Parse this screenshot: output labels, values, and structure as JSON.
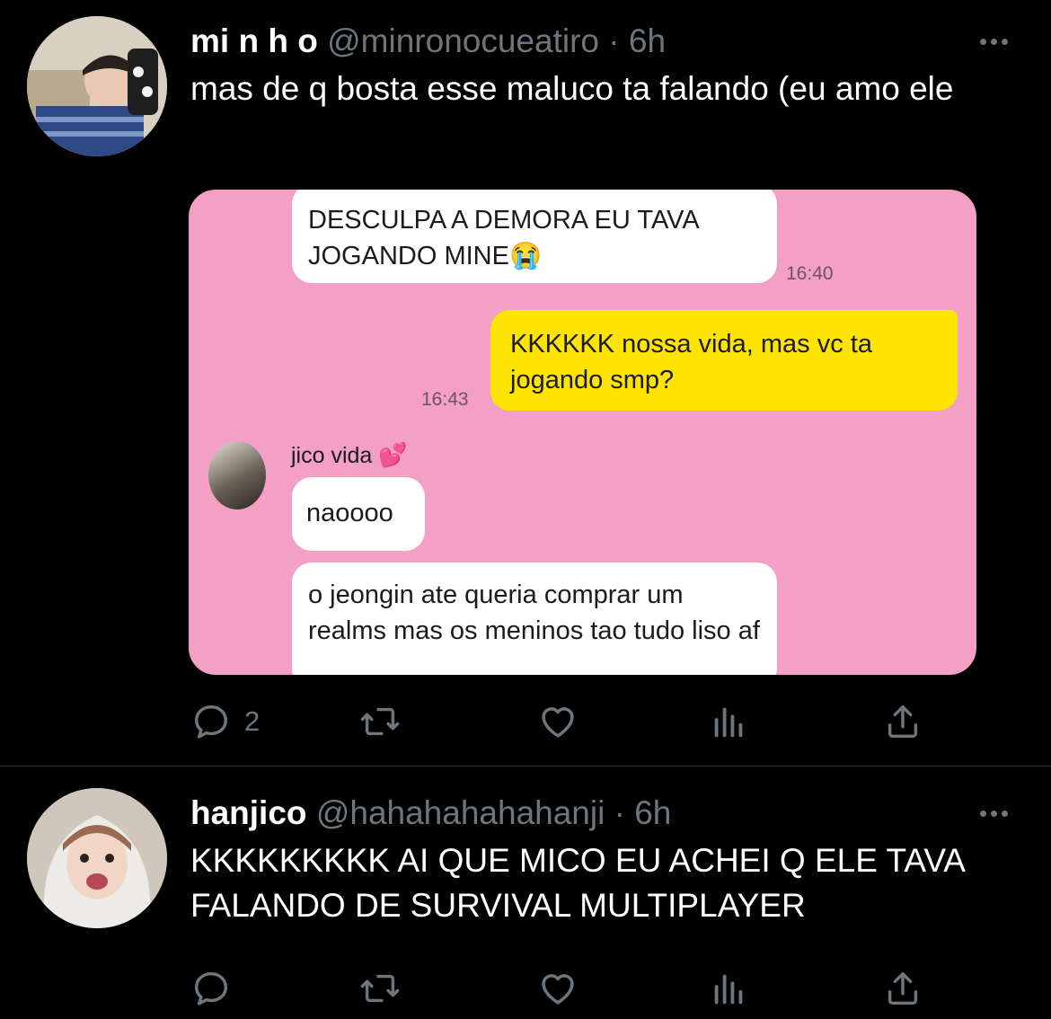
{
  "tweets": [
    {
      "display_name": "mi n h o",
      "handle": "@minronocueatiro",
      "separator": "·",
      "time": "6h",
      "text": "mas de q bosta esse maluco ta falando (eu amo ele",
      "reply_count": "2",
      "media": {
        "messages": [
          {
            "text": "DESCULPA A DEMORA EU TAVA JOGANDO MINE😭",
            "time": "16:40"
          },
          {
            "text": "KKKKKK nossa vida, mas vc ta jogando smp?",
            "time": "16:43"
          },
          {
            "text": "naoooo"
          },
          {
            "text": "o jeongin ate queria comprar um realms mas os meninos tao tudo liso af"
          }
        ],
        "contact_name": "jico vida",
        "contact_emoji": "💕"
      }
    },
    {
      "display_name": "hanjico",
      "handle": "@hahahahahahanji",
      "separator": "·",
      "time": "6h",
      "text": "KKKKKKKKK AI QUE MICO EU ACHEI Q ELE TAVA FALANDO DE SURVIVAL MULTIPLAYER",
      "reply_count": ""
    }
  ],
  "icons": {
    "more": "more-icon",
    "reply": "reply-icon",
    "retweet": "retweet-icon",
    "like": "heart-icon",
    "stats": "analytics-icon",
    "share": "share-icon"
  },
  "colors": {
    "background": "#000000",
    "secondary_text": "#6e767d",
    "media_background": "#f39fc6",
    "sent_bubble": "#fee500"
  }
}
